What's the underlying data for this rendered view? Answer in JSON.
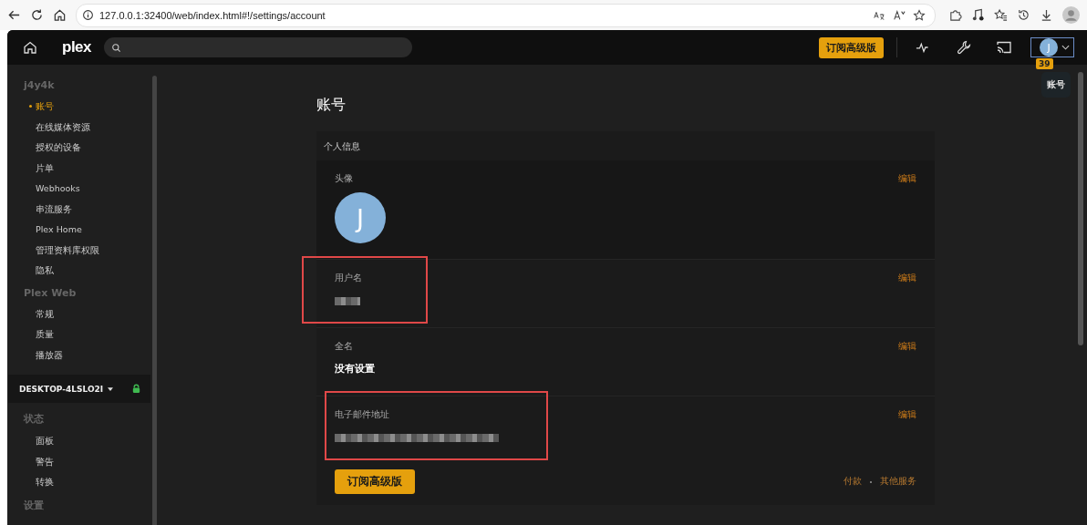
{
  "browser": {
    "url": "127.0.0.1:32400/web/index.html#!/settings/account"
  },
  "header": {
    "logo": "plex",
    "upgrade_button": "订阅高级版",
    "avatar_letter": "J",
    "badge": "39",
    "tooltip": "账号"
  },
  "sidebar": {
    "sections": [
      {
        "title": "j4y4k",
        "kind": "section",
        "items": [
          {
            "label": "账号",
            "selected": true
          },
          {
            "label": "在线媒体资源",
            "selected": false
          },
          {
            "label": "授权的设备",
            "selected": false
          },
          {
            "label": "片单",
            "selected": false
          },
          {
            "label": "Webhooks",
            "selected": false
          },
          {
            "label": "串流服务",
            "selected": false
          },
          {
            "label": "Plex Home",
            "selected": false
          },
          {
            "label": "管理资料库权限",
            "selected": false
          },
          {
            "label": "隐私",
            "selected": false
          }
        ]
      },
      {
        "title": "Plex Web",
        "kind": "section",
        "items": [
          {
            "label": "常规",
            "selected": false
          },
          {
            "label": "质量",
            "selected": false
          },
          {
            "label": "播放器",
            "selected": false
          }
        ]
      },
      {
        "title": "DESKTOP-4LSLO2I",
        "kind": "server"
      },
      {
        "title": "状态",
        "kind": "section",
        "items": [
          {
            "label": "面板",
            "selected": false
          },
          {
            "label": "警告",
            "selected": false
          },
          {
            "label": "转换",
            "selected": false
          }
        ]
      },
      {
        "title": "设置",
        "kind": "section"
      }
    ]
  },
  "page": {
    "title": "账号",
    "section": "个人信息",
    "rows": [
      {
        "label": "头像",
        "kind": "avatar",
        "value": "J",
        "edit": "编辑",
        "highlighted": false
      },
      {
        "label": "用户名",
        "kind": "redacted",
        "edit": "编辑",
        "highlighted": true
      },
      {
        "label": "全名",
        "kind": "text",
        "value": "没有设置",
        "edit": "编辑",
        "highlighted": false
      },
      {
        "label": "电子邮件地址",
        "kind": "redacted",
        "edit": "编辑",
        "highlighted": true
      }
    ],
    "subscribe_button": "订阅高级版",
    "links": [
      "付款",
      "其他服务"
    ]
  }
}
